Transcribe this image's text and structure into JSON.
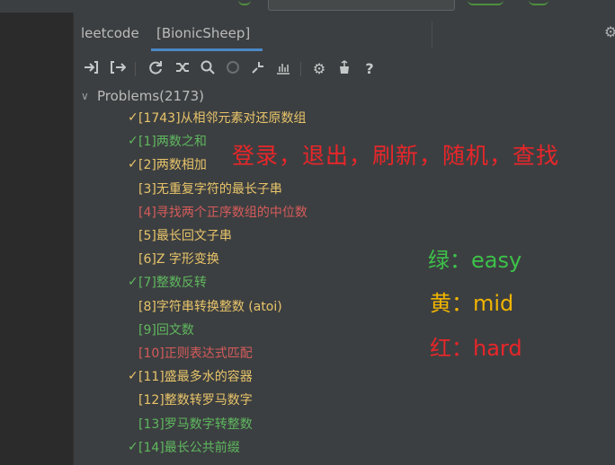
{
  "tabs": [
    {
      "label": "leetcode"
    },
    {
      "label": "[BionicSheep]"
    }
  ],
  "toolbar": {
    "icons": [
      "login-icon",
      "logout-icon",
      "refresh-icon",
      "random-icon",
      "search-icon",
      "cancel-icon",
      "collapse-icon",
      "chart-icon",
      "settings-icon",
      "donate-icon",
      "help-icon"
    ],
    "help_glyph": "?"
  },
  "tree": {
    "root_label": "Problems(2173)",
    "problems": [
      {
        "label": "[1743]从相邻元素对还原数组",
        "solved": true,
        "difficulty": "mid"
      },
      {
        "label": "[1]两数之和",
        "solved": true,
        "difficulty": "easy"
      },
      {
        "label": "[2]两数相加",
        "solved": true,
        "difficulty": "mid"
      },
      {
        "label": "[3]无重复字符的最长子串",
        "solved": false,
        "difficulty": "mid"
      },
      {
        "label": "[4]寻找两个正序数组的中位数",
        "solved": false,
        "difficulty": "hard"
      },
      {
        "label": "[5]最长回文子串",
        "solved": false,
        "difficulty": "mid"
      },
      {
        "label": "[6]Z 字形变换",
        "solved": false,
        "difficulty": "mid"
      },
      {
        "label": "[7]整数反转",
        "solved": true,
        "difficulty": "easy"
      },
      {
        "label": "[8]字符串转换整数 (atoi)",
        "solved": false,
        "difficulty": "mid"
      },
      {
        "label": "[9]回文数",
        "solved": false,
        "difficulty": "easy"
      },
      {
        "label": "[10]正则表达式匹配",
        "solved": false,
        "difficulty": "hard"
      },
      {
        "label": "[11]盛最多水的容器",
        "solved": true,
        "difficulty": "mid"
      },
      {
        "label": "[12]整数转罗马数字",
        "solved": false,
        "difficulty": "mid"
      },
      {
        "label": "[13]罗马数字转整数",
        "solved": false,
        "difficulty": "easy"
      },
      {
        "label": "[14]最长公共前缀",
        "solved": true,
        "difficulty": "easy"
      }
    ]
  },
  "annotations": {
    "actions": "登录，退出，刷新，随机，查找",
    "easy": "绿：easy",
    "mid": "黄：mid",
    "hard": "红：hard"
  },
  "colors": {
    "easy": "#5fb85f",
    "mid": "#e8c46a",
    "hard": "#d65b5b",
    "annotation_red": "#e8262a",
    "annotation_green": "#3cc24a",
    "annotation_yellow": "#f0b400",
    "tab_underline": "#4a88c7"
  }
}
